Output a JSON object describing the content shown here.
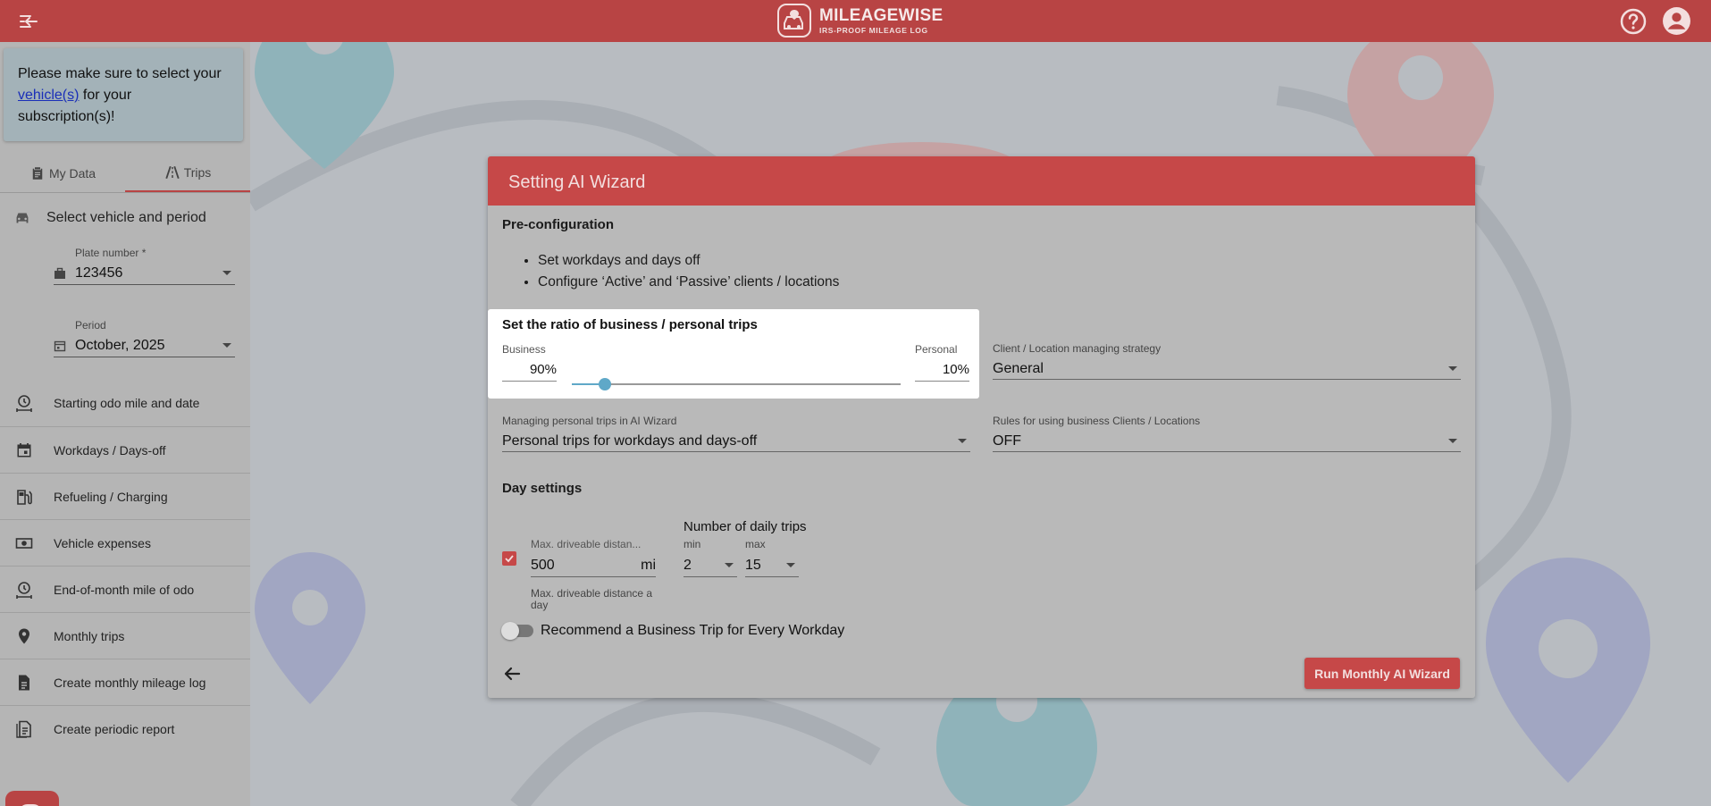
{
  "topbar": {
    "brand_name": "MILEAGEWISE",
    "brand_tagline": "IRS-PROOF MILEAGE LOG",
    "color": "#b84444"
  },
  "sidebar": {
    "notice": {
      "before": "Please make sure to select your ",
      "link": "vehicle(s)",
      "after": " for your subscription(s)!"
    },
    "tabs": [
      {
        "label": "My Data",
        "icon": "clipboard-icon",
        "active": false
      },
      {
        "label": "Trips",
        "icon": "road-icon",
        "active": true
      }
    ],
    "section_title": "Select vehicle and period",
    "plate_field": {
      "label": "Plate number *",
      "value": "123456"
    },
    "period_field": {
      "label": "Period",
      "value": "October, 2025"
    },
    "items": [
      {
        "label": "Starting odo mile and date",
        "icon": "odometer-clock-icon"
      },
      {
        "label": "Workdays / Days-off",
        "icon": "calendar-icon"
      },
      {
        "label": "Refueling / Charging",
        "icon": "fuel-pump-icon"
      },
      {
        "label": "Vehicle expenses",
        "icon": "cash-icon"
      },
      {
        "label": "End-of-month mile of odo",
        "icon": "odometer-clock-icon"
      },
      {
        "label": "Monthly trips",
        "icon": "location-pin-icon"
      },
      {
        "label": "Create monthly mileage log",
        "icon": "document-icon"
      },
      {
        "label": "Create periodic report",
        "icon": "report-icon"
      }
    ]
  },
  "dialog": {
    "title": "Setting AI Wizard",
    "preconfig_title": "Pre-configuration",
    "bullets": [
      "Set workdays and days off",
      "Configure ‘Active’ and ‘Passive’ clients / locations"
    ],
    "ratio": {
      "title": "Set the ratio of business / personal trips",
      "business_label": "Business",
      "business_value": "90%",
      "personal_label": "Personal",
      "personal_value": "10%",
      "slider_fraction": 0.1
    },
    "client_strategy": {
      "label": "Client / Location managing strategy",
      "value": "General"
    },
    "personal_trips": {
      "label": "Managing personal trips in AI Wizard",
      "value": "Personal trips for workdays and days-off"
    },
    "rules": {
      "label": "Rules for using business Clients / Locations",
      "value": "OFF"
    },
    "day_settings_title": "Day settings",
    "max_distance": {
      "label": "Max. driveable distan...",
      "value": "500",
      "unit": "mi",
      "hint": "Max. driveable distance a day",
      "checked": true
    },
    "daily_trips": {
      "title": "Number of daily trips",
      "min_label": "min",
      "min_value": "2",
      "max_label": "max",
      "max_value": "15"
    },
    "recommend_toggle": {
      "label": "Recommend a Business Trip for Every Workday",
      "on": false
    },
    "run_button": "Run Monthly AI Wizard"
  }
}
